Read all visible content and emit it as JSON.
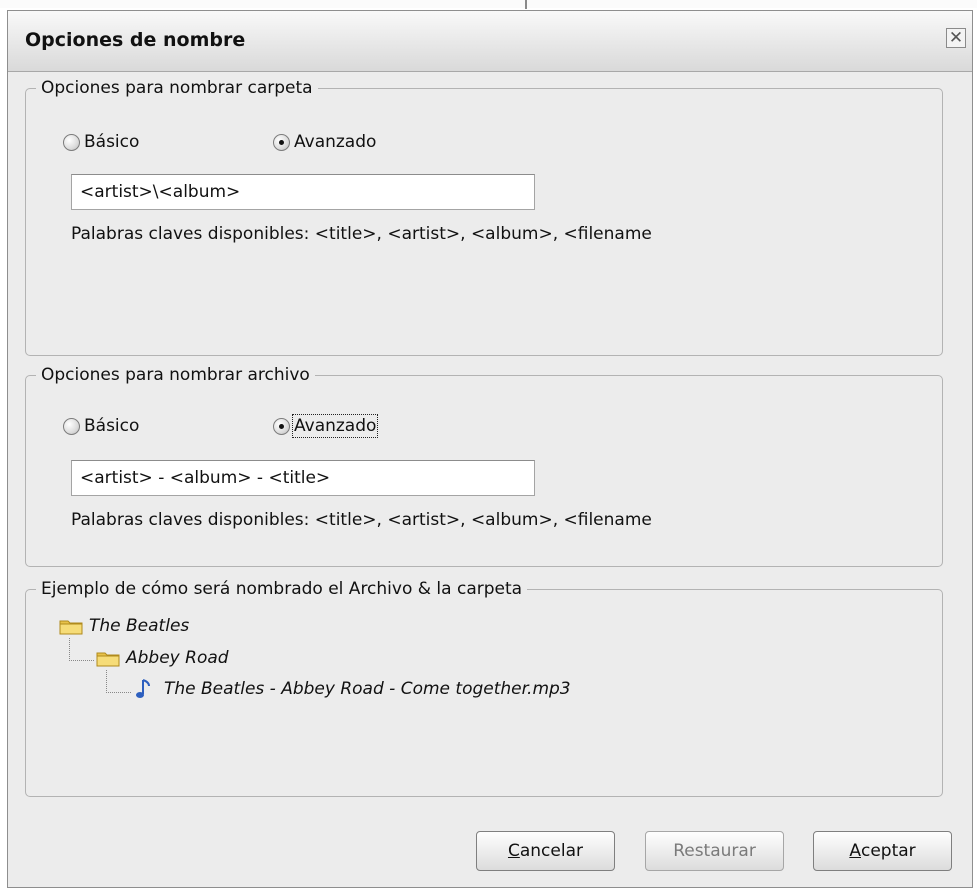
{
  "dialog": {
    "title": "Opciones de nombre",
    "close_symbol": "✕"
  },
  "folder_group": {
    "legend": "Opciones para nombrar carpeta",
    "radio_basic": "Básico",
    "radio_advanced": "Avanzado",
    "selected": "advanced",
    "pattern_value": "<artist>\\<album>",
    "keywords": "Palabras claves disponibles: <title>, <artist>, <album>, <filename"
  },
  "file_group": {
    "legend": "Opciones para nombrar archivo",
    "radio_basic": "Básico",
    "radio_advanced": "Avanzado",
    "selected": "advanced",
    "pattern_value": "<artist> - <album> - <title>",
    "keywords": "Palabras claves disponibles: <title>, <artist>, <album>, <filename"
  },
  "example_group": {
    "legend": "Ejemplo de cómo será nombrado el Archivo & la carpeta",
    "tree": {
      "level1": "The Beatles",
      "level2": "Abbey Road",
      "level3": "The Beatles - Abbey Road - Come together.mp3"
    },
    "icons": [
      "folder-icon",
      "folder-icon",
      "music-note-icon"
    ]
  },
  "buttons": {
    "cancel": {
      "first": "C",
      "rest": "ancelar"
    },
    "restore": "Restaurar",
    "accept": {
      "first": "A",
      "rest": "ceptar"
    }
  },
  "colors": {
    "dialog_bg": "#ececec",
    "folder_yellow": "#f2d15a",
    "note_blue": "#2d5fbf"
  }
}
